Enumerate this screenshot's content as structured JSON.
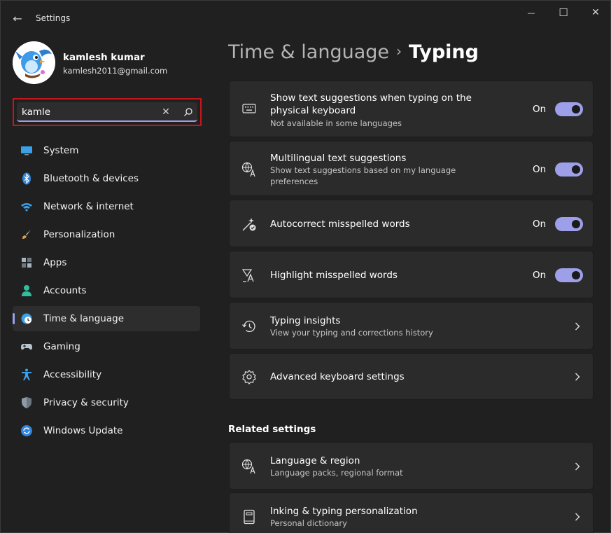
{
  "window": {
    "title": "Settings",
    "back_glyph": "←",
    "minimize_glyph": "—",
    "maximize_glyph": "☐",
    "close_glyph": "✕"
  },
  "profile": {
    "name": "kamlesh kumar",
    "email": "kamlesh2011@gmail.com",
    "avatar_icon": "bird-avatar"
  },
  "search": {
    "value": "kamle",
    "clear_glyph": "✕",
    "icon": "search-icon",
    "highlight_color": "#c4161c"
  },
  "sidebar": {
    "items": [
      {
        "label": "System",
        "icon": "monitor-icon",
        "selected": false
      },
      {
        "label": "Bluetooth & devices",
        "icon": "bluetooth-icon",
        "selected": false
      },
      {
        "label": "Network & internet",
        "icon": "wifi-icon",
        "selected": false
      },
      {
        "label": "Personalization",
        "icon": "brush-icon",
        "selected": false
      },
      {
        "label": "Apps",
        "icon": "apps-icon",
        "selected": false
      },
      {
        "label": "Accounts",
        "icon": "person-icon",
        "selected": false
      },
      {
        "label": "Time & language",
        "icon": "globe-clock-icon",
        "selected": true
      },
      {
        "label": "Gaming",
        "icon": "gamepad-icon",
        "selected": false
      },
      {
        "label": "Accessibility",
        "icon": "accessibility-icon",
        "selected": false
      },
      {
        "label": "Privacy & security",
        "icon": "shield-icon",
        "selected": false
      },
      {
        "label": "Windows Update",
        "icon": "update-icon",
        "selected": false
      }
    ]
  },
  "header": {
    "parent": "Time & language",
    "separator": "›",
    "current": "Typing"
  },
  "settings": [
    {
      "title": "Show text suggestions when typing on the physical keyboard",
      "subtitle": "Not available in some languages",
      "icon": "keyboard-icon",
      "control": "toggle",
      "state": "On"
    },
    {
      "title": "Multilingual text suggestions",
      "subtitle": "Show text suggestions based on my language preferences",
      "icon": "translate-icon",
      "control": "toggle",
      "state": "On"
    },
    {
      "title": "Autocorrect misspelled words",
      "subtitle": "",
      "icon": "autocorrect-icon",
      "control": "toggle",
      "state": "On"
    },
    {
      "title": "Highlight misspelled words",
      "subtitle": "",
      "icon": "spellcheck-icon",
      "control": "toggle",
      "state": "On"
    },
    {
      "title": "Typing insights",
      "subtitle": "View your typing and corrections history",
      "icon": "history-icon",
      "control": "chevron"
    },
    {
      "title": "Advanced keyboard settings",
      "subtitle": "",
      "icon": "gear-icon",
      "control": "chevron"
    }
  ],
  "related": {
    "heading": "Related settings",
    "items": [
      {
        "title": "Language & region",
        "subtitle": "Language packs, regional format",
        "icon": "language-region-icon"
      },
      {
        "title": "Inking & typing personalization",
        "subtitle": "Personal dictionary",
        "icon": "book-icon"
      }
    ]
  },
  "colors": {
    "accent": "#9da0e8",
    "background": "#202020",
    "card": "#2b2b2b"
  }
}
